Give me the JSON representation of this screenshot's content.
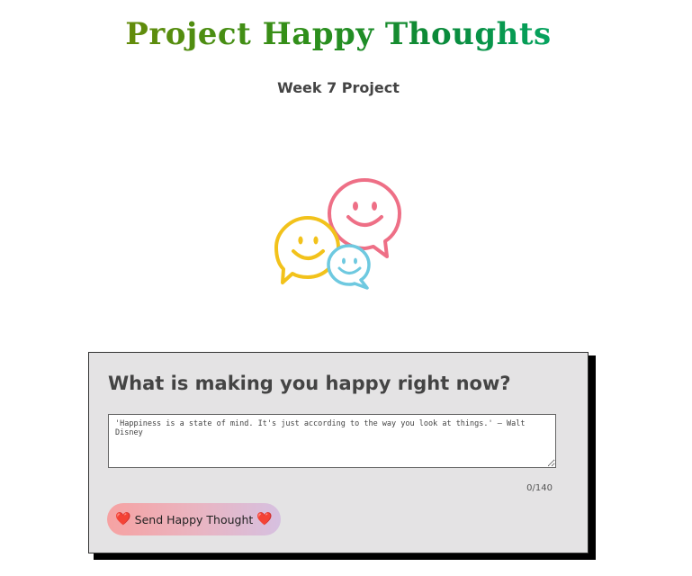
{
  "header": {
    "title": "Project Happy Thoughts",
    "subtitle": "Week 7 Project"
  },
  "logo": {
    "icon": "smiley-chat-bubbles-icon",
    "colors": {
      "yellow": "#f2c21b",
      "pink": "#ee6f86",
      "blue": "#6ec9e0"
    }
  },
  "form": {
    "question": "What is making you happy right now?",
    "placeholder": "'Happiness is a state of mind. It's just according to the way you look at things.' — Walt Disney",
    "value": "",
    "counter": "0/140",
    "send_label": "Send Happy Thought",
    "heart_left": "❤️",
    "heart_right": "❤️"
  },
  "colors": {
    "card_background": "#e4e3e4",
    "card_shadow": "#000000",
    "title_gradient_start": "#8a8a00",
    "title_gradient_end": "#00c08a",
    "button_gradient_start": "#f6a2a2",
    "button_gradient_end": "#d6c0e0"
  }
}
